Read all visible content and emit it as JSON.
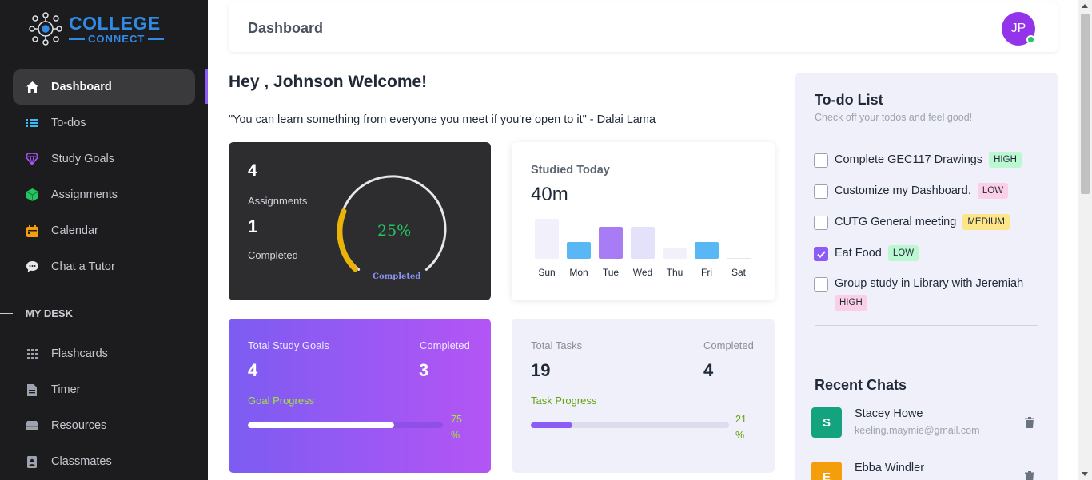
{
  "brand": {
    "line1": "COLLEGE",
    "line2": "CONNECT",
    "color": "#2f8be6"
  },
  "sidebar": {
    "items": [
      {
        "label": "Dashboard",
        "icon": "home-icon",
        "active": true
      },
      {
        "label": "To-dos",
        "icon": "list-icon"
      },
      {
        "label": "Study Goals",
        "icon": "diamond-icon"
      },
      {
        "label": "Assignments",
        "icon": "cube-icon"
      },
      {
        "label": "Calendar",
        "icon": "calendar-icon"
      },
      {
        "label": "Chat a Tutor",
        "icon": "chat-bubble-icon"
      }
    ],
    "section_label": "MY DESK",
    "desk_items": [
      {
        "label": "Flashcards",
        "icon": "grid-icon"
      },
      {
        "label": "Timer",
        "icon": "document-icon"
      },
      {
        "label": "Resources",
        "icon": "stack-icon"
      },
      {
        "label": "Classmates",
        "icon": "contact-icon"
      }
    ]
  },
  "header": {
    "title": "Dashboard",
    "avatar_initials": "JP",
    "accent": "#9333ea"
  },
  "main": {
    "welcome": "Hey , Johnson Welcome!",
    "quote": "\"You can learn something from everyone you meet if you're open to it\" - Dalai Lama",
    "assignments_card": {
      "total": "4",
      "total_label": "Assignments",
      "completed": "1",
      "completed_label": "Completed",
      "percent_text": "25%",
      "percent": 25,
      "gauge_label": "Completed"
    },
    "studied_card": {
      "title": "Studied Today",
      "value": "40m",
      "days": [
        {
          "day": "Sun",
          "level": 0.6,
          "color": "#f1f0fb"
        },
        {
          "day": "Mon",
          "level": 0.25,
          "color": "#5ab7f5"
        },
        {
          "day": "Tue",
          "level": 0.48,
          "color": "#a77cf4"
        },
        {
          "day": "Wed",
          "level": 0.48,
          "color": "#e4e2fa"
        },
        {
          "day": "Thu",
          "level": 0.15,
          "color": "#f1f0fb"
        },
        {
          "day": "Fri",
          "level": 0.25,
          "color": "#5ab7f5"
        },
        {
          "day": "Sat",
          "level": 0.01,
          "color": "#e5e7eb"
        }
      ]
    },
    "goals_card": {
      "total_label": "Total Study Goals",
      "completed_label": "Completed",
      "total": "4",
      "completed": "3",
      "progress_label": "Goal Progress",
      "percent_text": "75 %",
      "percent": 75
    },
    "tasks_card": {
      "total_label": "Total Tasks",
      "completed_label": "Completed",
      "total": "19",
      "completed": "4",
      "progress_label": "Task Progress",
      "percent_text": "21 %",
      "percent": 21
    }
  },
  "todo_panel": {
    "title": "To-do List",
    "subtitle": "Check off your todos and feel good!",
    "items": [
      {
        "text": "Complete GEC117 Drawings",
        "tag": "HIGH",
        "checked": false
      },
      {
        "text": "Customize my Dashboard.",
        "tag": "LOW",
        "checked": false
      },
      {
        "text": "CUTG General meeting",
        "tag": "MEDIUM",
        "checked": false
      },
      {
        "text": "Eat Food",
        "tag": "LOW",
        "checked": true
      },
      {
        "text": "Group study in Library with Jeremiah",
        "tag": "HIGH",
        "checked": false
      }
    ],
    "recent_title": "Recent Chats",
    "chats": [
      {
        "initial": "S",
        "name": "Stacey Howe",
        "email": "keeling.maymie@gmail.com",
        "color": "#14a37f"
      },
      {
        "initial": "E",
        "name": "Ebba Windler",
        "email": "",
        "color": "#f59e0b"
      }
    ]
  }
}
